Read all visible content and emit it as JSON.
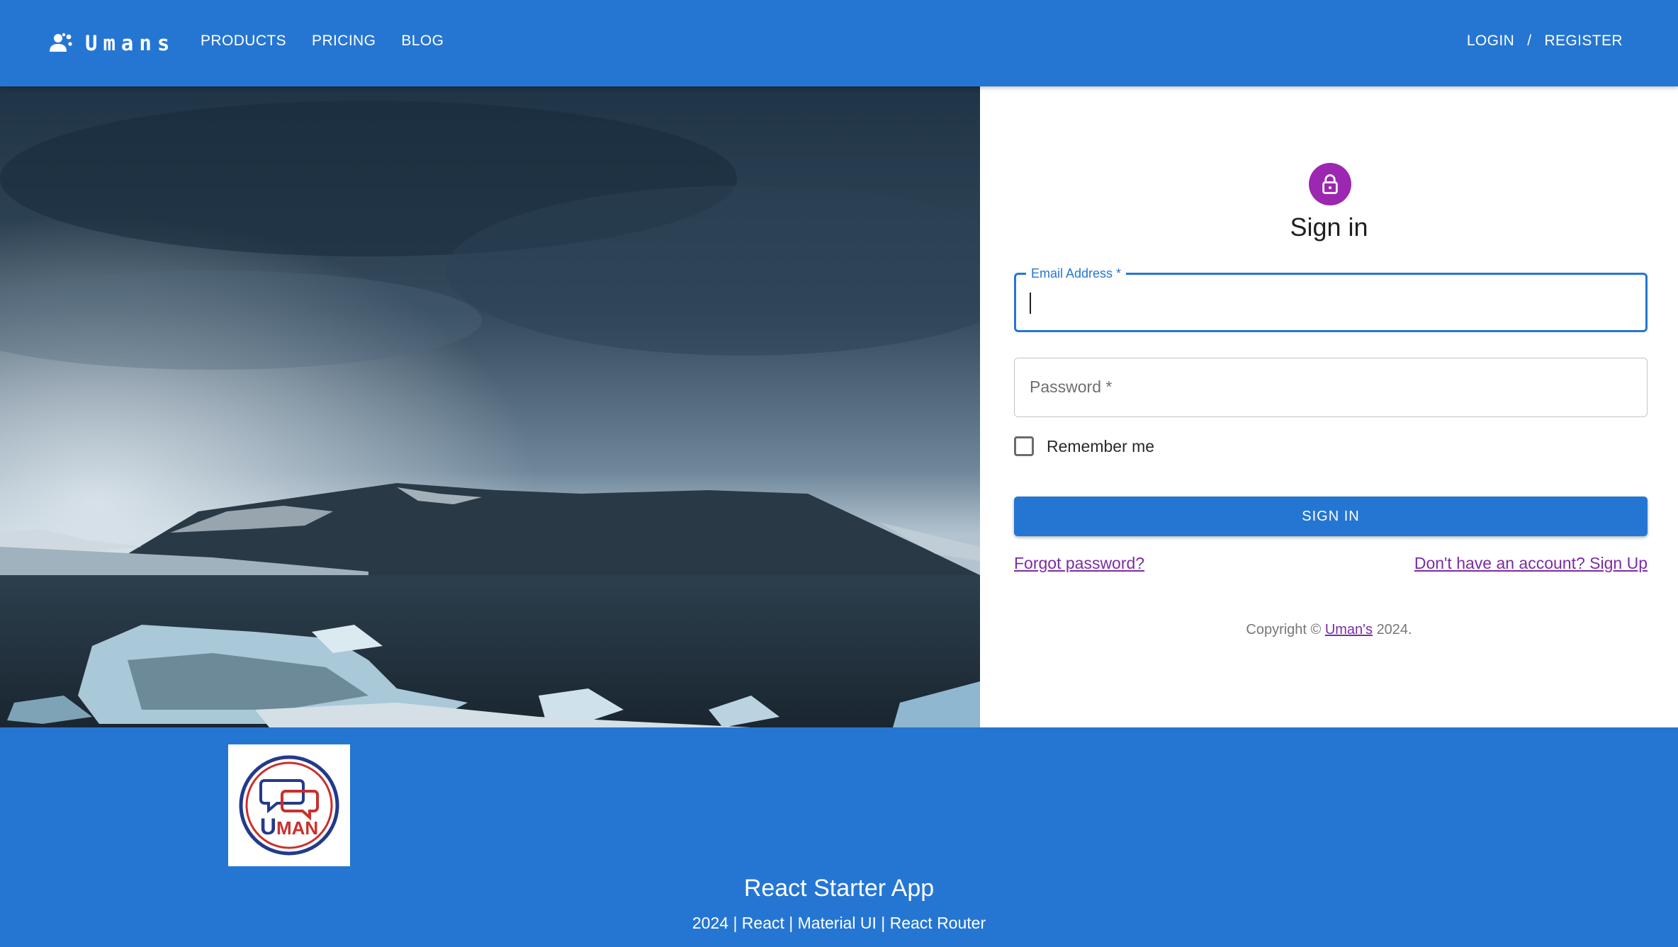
{
  "header": {
    "brand": "Umans",
    "brand_icon": "users-group-icon",
    "nav": [
      {
        "label": "PRODUCTS"
      },
      {
        "label": "PRICING"
      },
      {
        "label": "BLOG"
      }
    ],
    "auth": {
      "login": "LOGIN",
      "separator": "/",
      "register": "REGISTER"
    }
  },
  "hero": {
    "image": "glacier-lagoon-icebergs-mountains"
  },
  "signin": {
    "icon": "lock-icon",
    "title": "Sign in",
    "email": {
      "label": "Email Address *",
      "value": ""
    },
    "password": {
      "placeholder": "Password *",
      "value": ""
    },
    "remember_label": "Remember me",
    "remember_checked": false,
    "button_label": "SIGN IN",
    "forgot_link": "Forgot password?",
    "signup_link": "Don't have an account? Sign Up",
    "copyright_prefix": "Copyright ©",
    "copyright_link": "Uman's",
    "copyright_suffix": "2024."
  },
  "footer": {
    "logo_text": "UMAN",
    "title": "React Starter App",
    "subtitle": "2024 | React | Material UI | React Router"
  },
  "colors": {
    "primary": "#2576d2",
    "avatar": "#9c27b0",
    "link": "#7b2ca3"
  }
}
